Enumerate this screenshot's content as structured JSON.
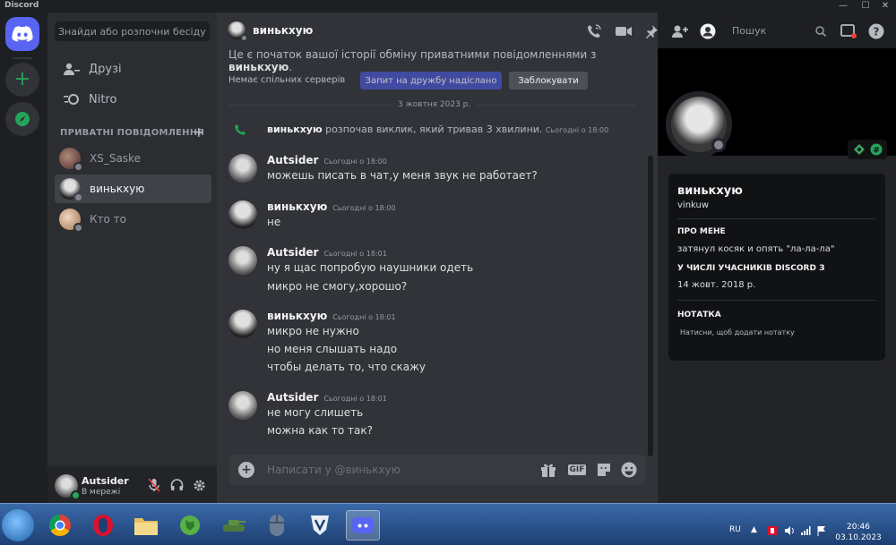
{
  "window": {
    "title": "Discord",
    "minimize": "—",
    "maximize": "☐",
    "close": "✕"
  },
  "dm_search": {
    "placeholder": "Знайди або розпочни бесіду"
  },
  "nav": {
    "friends": "Друзі",
    "nitro": "Nitro"
  },
  "dm_list": {
    "header": "ПРИВАТНІ ПОВІДОМЛЕННЯ",
    "items": [
      {
        "name": "XS_Saske"
      },
      {
        "name": "винькхую",
        "active": true
      },
      {
        "name": "Кто то"
      }
    ]
  },
  "user_panel": {
    "name": "Autsider",
    "status": "В мережі"
  },
  "topbar": {
    "channel_name": "винькхую",
    "search_placeholder": "Пошук"
  },
  "chat": {
    "intro_prefix": "Це є початок вашої історії обміну приватними повідомленнями з",
    "intro_name": "винькхую",
    "no_servers": "Немає спільних серверів",
    "friend_request_button": "Запит на дружбу надіслано",
    "block_button": "Заблокувати",
    "date_divider": "3 жовтня 2023 р.",
    "call_event": {
      "user": "винькхую",
      "text": "розпочав виклик, який тривав 3 хвилини.",
      "time": "Сьогодні о 18:00"
    },
    "messages": [
      {
        "author": "Autsider",
        "time": "Сьогодні о 18:00",
        "lines": [
          "можешь писать в чат,у меня звук не работает?"
        ]
      },
      {
        "author": "винькхую",
        "time": "Сьогодні о 18:00",
        "lines": [
          "не"
        ]
      },
      {
        "author": "Autsider",
        "time": "Сьогодні о 18:01",
        "lines": [
          "ну я щас попробую наушники одеть",
          "микро не смогу,хорошо?"
        ]
      },
      {
        "author": "винькхую",
        "time": "Сьогодні о 18:01",
        "lines": [
          "микро не нужно",
          "но меня слышать надо",
          "чтобы делать то, что скажу"
        ]
      },
      {
        "author": "Autsider",
        "time": "Сьогодні о 18:01",
        "lines": [
          "не могу слишеть",
          "можна как то так?"
        ]
      }
    ],
    "composer_placeholder": "Написати у @винькхую"
  },
  "profile": {
    "display_name": "винькхую",
    "username": "vinkuw",
    "about_header": "ПРО МЕНЕ",
    "about_text": "затянул косяк и опять \"ла-ла-ла\"",
    "member_since_header": "У ЧИСЛІ УЧАСНИКІВ DISCORD З",
    "member_since": "14 жовт. 2018 р.",
    "note_header": "НОТАТКА",
    "note_placeholder": "Натисни, щоб додати нотатку"
  },
  "taskbar": {
    "language": "RU",
    "time": "20:46",
    "date": "03.10.2023"
  },
  "colors": {
    "accent": "#5865f2",
    "online": "#23a55a",
    "offline": "#80848e",
    "call_green": "#23a55a"
  }
}
